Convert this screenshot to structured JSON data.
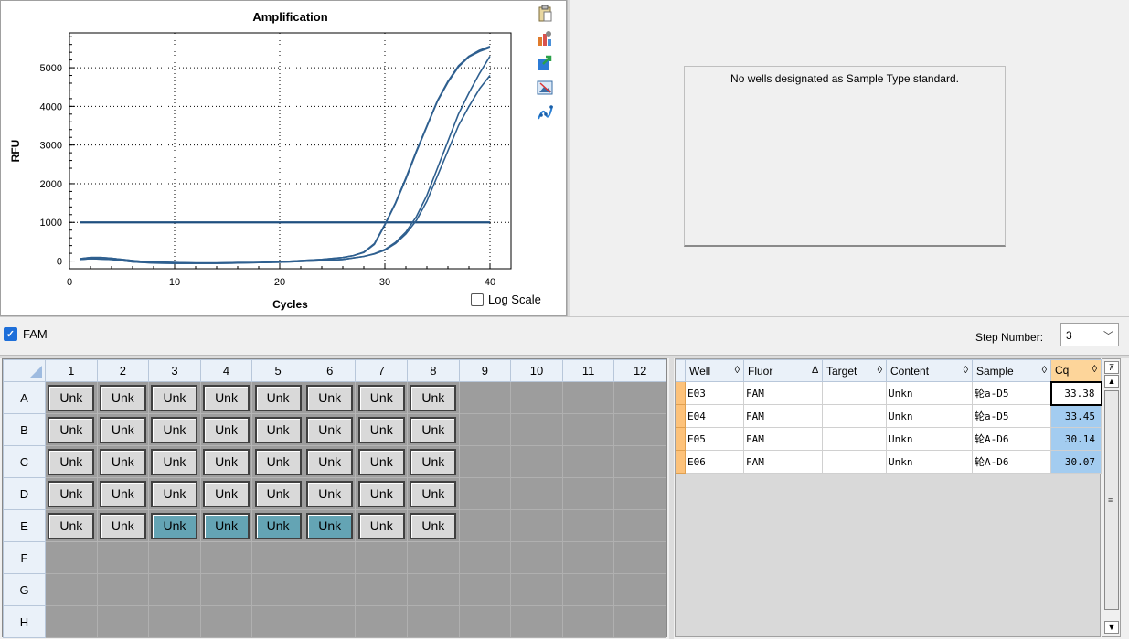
{
  "chart": {
    "title": "Amplification",
    "xlabel": "Cycles",
    "ylabel": "RFU",
    "log_scale_label": "Log Scale",
    "log_scale_checked": false
  },
  "chart_data": {
    "type": "line",
    "title": "Amplification",
    "xlabel": "Cycles",
    "ylabel": "RFU",
    "xlim": [
      0,
      42
    ],
    "ylim": [
      -200,
      5900
    ],
    "xticks": [
      0,
      10,
      20,
      30,
      40
    ],
    "yticks": [
      0,
      1000,
      2000,
      3000,
      4000,
      5000
    ],
    "grid": true,
    "threshold": 1000,
    "series": [
      {
        "x": [
          1,
          2,
          3,
          4,
          5,
          6,
          7,
          8,
          10,
          12,
          14,
          16,
          18,
          20,
          22,
          24,
          26,
          27,
          28,
          29,
          30,
          31,
          32,
          33,
          34,
          35,
          36,
          37,
          38,
          39,
          40
        ],
        "y": [
          60,
          90,
          90,
          70,
          40,
          10,
          -10,
          -20,
          -40,
          -50,
          -50,
          -40,
          -40,
          -20,
          10,
          40,
          90,
          140,
          230,
          450,
          950,
          1500,
          2150,
          2850,
          3500,
          4150,
          4650,
          5050,
          5300,
          5450,
          5550
        ]
      },
      {
        "x": [
          1,
          2,
          3,
          4,
          5,
          6,
          7,
          8,
          10,
          12,
          14,
          16,
          18,
          20,
          22,
          24,
          26,
          27,
          28,
          29,
          30,
          31,
          32,
          33,
          34,
          35,
          36,
          37,
          38,
          39,
          40
        ],
        "y": [
          60,
          90,
          90,
          70,
          40,
          10,
          -10,
          -20,
          -40,
          -50,
          -50,
          -40,
          -40,
          -20,
          10,
          40,
          90,
          140,
          220,
          430,
          930,
          1480,
          2120,
          2820,
          3480,
          4130,
          4620,
          5020,
          5280,
          5420,
          5520
        ]
      },
      {
        "x": [
          1,
          2,
          4,
          6,
          8,
          10,
          12,
          14,
          16,
          18,
          20,
          22,
          24,
          26,
          28,
          29,
          30,
          31,
          32,
          33,
          34,
          35,
          36,
          37,
          38,
          39,
          40
        ],
        "y": [
          40,
          60,
          40,
          -20,
          -50,
          -60,
          -60,
          -60,
          -50,
          -40,
          -30,
          -10,
          10,
          40,
          120,
          190,
          300,
          480,
          750,
          1150,
          1700,
          2400,
          3100,
          3800,
          4350,
          4850,
          5300
        ]
      },
      {
        "x": [
          1,
          2,
          4,
          6,
          8,
          10,
          12,
          14,
          16,
          18,
          20,
          22,
          24,
          26,
          28,
          29,
          30,
          31,
          32,
          33,
          34,
          35,
          36,
          37,
          38,
          39,
          40
        ],
        "y": [
          40,
          60,
          40,
          -20,
          -50,
          -60,
          -60,
          -60,
          -50,
          -40,
          -30,
          -10,
          10,
          40,
          120,
          180,
          280,
          450,
          700,
          1050,
          1550,
          2200,
          2850,
          3500,
          4000,
          4450,
          4800
        ]
      }
    ]
  },
  "tools": [
    "clipboard-icon",
    "chart-settings-icon",
    "export-icon",
    "image-icon",
    "curve-fit-icon"
  ],
  "standard_curve": {
    "message": "No wells designated as Sample Type standard."
  },
  "fluor": {
    "label": "FAM",
    "checked": true,
    "step_label": "Step Number:",
    "step_value": "3"
  },
  "plate": {
    "columns": [
      "1",
      "2",
      "3",
      "4",
      "5",
      "6",
      "7",
      "8",
      "9",
      "10",
      "11",
      "12"
    ],
    "rows": [
      "A",
      "B",
      "C",
      "D",
      "E",
      "F",
      "G",
      "H"
    ],
    "well_label": "Unk",
    "filled_rows": [
      "A",
      "B",
      "C",
      "D",
      "E"
    ],
    "filled_cols": 8,
    "selected": [
      "E3",
      "E4",
      "E5",
      "E6"
    ]
  },
  "results": {
    "headers": [
      "Well",
      "Fluor",
      "Target",
      "Content",
      "Sample",
      "Cq"
    ],
    "sort_glyphs": [
      "◊",
      "∆",
      "◊",
      "◊",
      "◊",
      "◊"
    ],
    "rows": [
      {
        "well": "E03",
        "fluor": "FAM",
        "target": "",
        "content": "Unkn",
        "sample": "轮a-D5",
        "cq": "33.38"
      },
      {
        "well": "E04",
        "fluor": "FAM",
        "target": "",
        "content": "Unkn",
        "sample": "轮a-D5",
        "cq": "33.45"
      },
      {
        "well": "E05",
        "fluor": "FAM",
        "target": "",
        "content": "Unkn",
        "sample": "轮A-D6",
        "cq": "30.14"
      },
      {
        "well": "E06",
        "fluor": "FAM",
        "target": "",
        "content": "Unkn",
        "sample": "轮A-D6",
        "cq": "30.07"
      }
    ]
  },
  "colors": {
    "curve": "#2e5f8f",
    "threshold": "#1f4f7f",
    "selected_well": "#64a4b4",
    "cq_highlight": "#a3ccf0",
    "cq_header": "#fdd59a"
  }
}
